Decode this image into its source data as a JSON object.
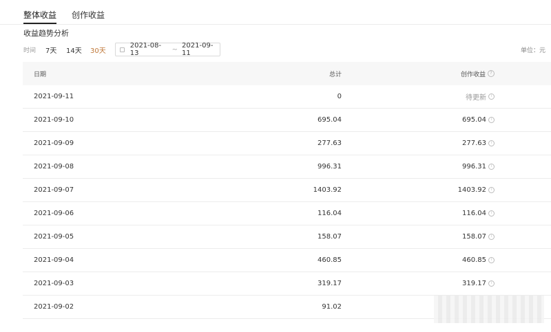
{
  "tabs": [
    {
      "label": "整体收益",
      "active": true
    },
    {
      "label": "创作收益",
      "active": false
    }
  ],
  "section_title": "收益趋势分析",
  "filter": {
    "label": "时间",
    "ranges": [
      {
        "label": "7天",
        "active": false
      },
      {
        "label": "14天",
        "active": false
      },
      {
        "label": "30天",
        "active": true
      }
    ],
    "date_start": "2021-08-13",
    "date_sep": "~",
    "date_end": "2021-09-11",
    "unit": "单位：元"
  },
  "table": {
    "headers": {
      "date": "日期",
      "total": "总计",
      "earnings": "创作收益"
    },
    "rows": [
      {
        "date": "2021-09-11",
        "total": "0",
        "earnings": "待更新"
      },
      {
        "date": "2021-09-10",
        "total": "695.04",
        "earnings": "695.04"
      },
      {
        "date": "2021-09-09",
        "total": "277.63",
        "earnings": "277.63"
      },
      {
        "date": "2021-09-08",
        "total": "996.31",
        "earnings": "996.31"
      },
      {
        "date": "2021-09-07",
        "total": "1403.92",
        "earnings": "1403.92"
      },
      {
        "date": "2021-09-06",
        "total": "116.04",
        "earnings": "116.04"
      },
      {
        "date": "2021-09-05",
        "total": "158.07",
        "earnings": "158.07"
      },
      {
        "date": "2021-09-04",
        "total": "460.85",
        "earnings": "460.85"
      },
      {
        "date": "2021-09-03",
        "total": "319.17",
        "earnings": "319.17"
      },
      {
        "date": "2021-09-02",
        "total": "91.02",
        "earnings": ""
      }
    ]
  },
  "colors": {
    "accent": "#c0793a",
    "pending": "#999999"
  }
}
